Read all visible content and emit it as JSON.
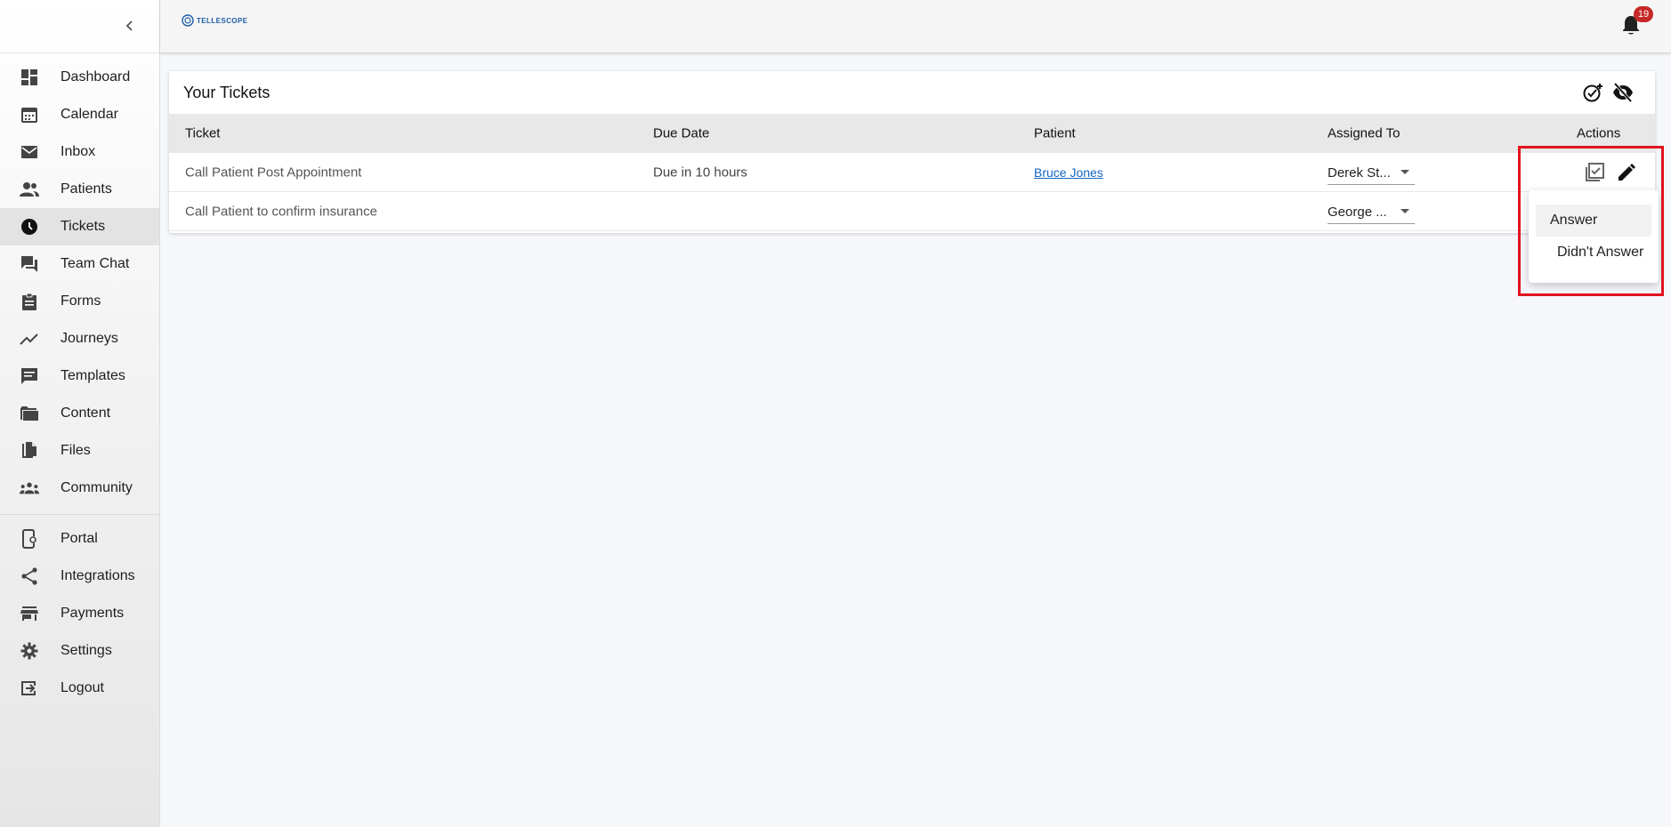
{
  "sidebar": {
    "collapse_icon": "chevron-left-icon",
    "items": [
      {
        "label": "Dashboard",
        "icon": "dashboard-icon"
      },
      {
        "label": "Calendar",
        "icon": "calendar-icon"
      },
      {
        "label": "Inbox",
        "icon": "mail-icon"
      },
      {
        "label": "Patients",
        "icon": "people-icon"
      },
      {
        "label": "Tickets",
        "icon": "clock-icon",
        "active": true
      },
      {
        "label": "Team Chat",
        "icon": "chat-icon"
      },
      {
        "label": "Forms",
        "icon": "clipboard-icon"
      },
      {
        "label": "Journeys",
        "icon": "trending-icon"
      },
      {
        "label": "Templates",
        "icon": "message-icon"
      },
      {
        "label": "Content",
        "icon": "folder-icon"
      },
      {
        "label": "Files",
        "icon": "file-copy-icon"
      },
      {
        "label": "Community",
        "icon": "groups-icon"
      }
    ],
    "items2": [
      {
        "label": "Portal",
        "icon": "portal-icon"
      },
      {
        "label": "Integrations",
        "icon": "share-icon"
      },
      {
        "label": "Payments",
        "icon": "store-icon"
      },
      {
        "label": "Settings",
        "icon": "gear-icon"
      },
      {
        "label": "Logout",
        "icon": "logout-icon"
      }
    ]
  },
  "topbar": {
    "logo_text": "TELLESCOPE",
    "notification_count": "19"
  },
  "tickets": {
    "title": "Your Tickets",
    "columns": [
      "Ticket",
      "Due Date",
      "Patient",
      "Assigned To",
      "Actions"
    ],
    "rows": [
      {
        "ticket": "Call Patient Post Appointment",
        "due": "Due in 10 hours",
        "patient": "Bruce Jones",
        "assigned": "Derek St..."
      },
      {
        "ticket": "Call Patient to confirm insurance",
        "due": "",
        "patient": "",
        "assigned": "George ..."
      }
    ]
  },
  "menu": {
    "items": [
      "Answer",
      "Didn't Answer"
    ]
  },
  "colors": {
    "accent": "#1565c0",
    "badge": "#c62828",
    "highlight": "#e0141e"
  }
}
